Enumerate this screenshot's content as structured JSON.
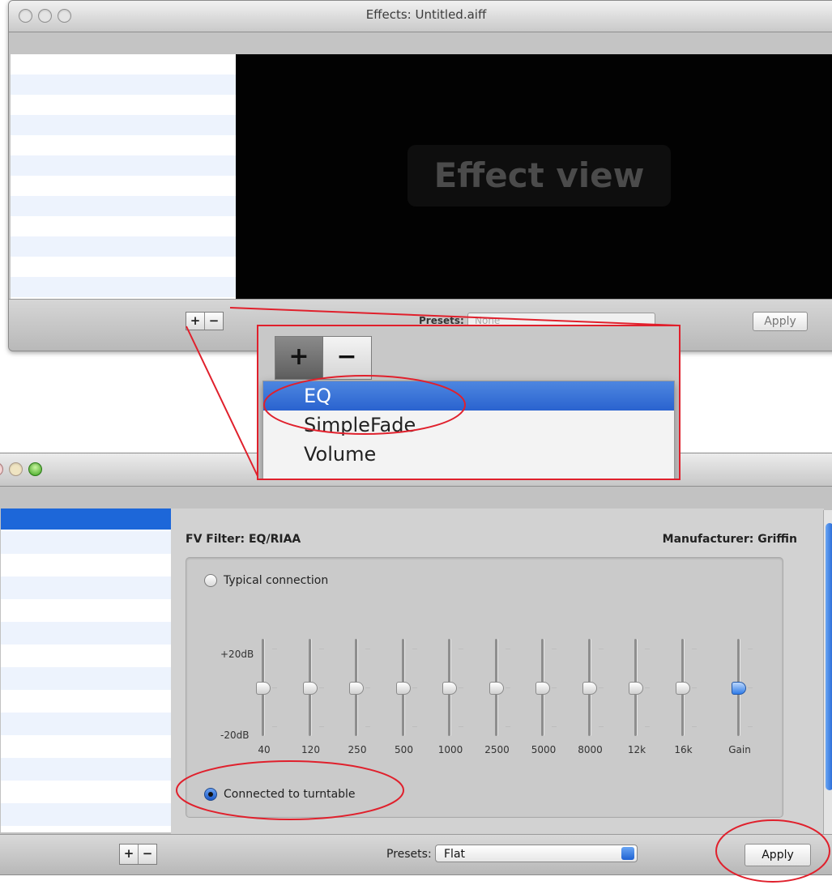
{
  "top_window": {
    "title": "Effects: Untitled.aiff",
    "effect_view_label": "Effect view",
    "add_symbol": "+",
    "remove_symbol": "−",
    "presets_label": "Presets:",
    "presets_value": "None",
    "apply_label": "Apply"
  },
  "zoom": {
    "add_symbol": "+",
    "remove_symbol": "−",
    "menu_items": [
      "EQ",
      "SimpleFade",
      "Volume"
    ],
    "highlighted_item": "EQ"
  },
  "bottom_window": {
    "filter_title": "FV Filter: EQ/RIAA",
    "manufacturer": "Manufacturer: Griffin",
    "radio_typical": "Typical connection",
    "radio_turntable": "Connected to turntable",
    "selected_radio": "Connected to turntable",
    "db_top": "+20dB",
    "db_bottom": "-20dB",
    "bands": [
      {
        "label": "40",
        "level": 0.5
      },
      {
        "label": "120",
        "level": 0.5
      },
      {
        "label": "250",
        "level": 0.5
      },
      {
        "label": "500",
        "level": 0.5
      },
      {
        "label": "1000",
        "level": 0.5
      },
      {
        "label": "2500",
        "level": 0.5
      },
      {
        "label": "5000",
        "level": 0.5
      },
      {
        "label": "8000",
        "level": 0.5
      },
      {
        "label": "12k",
        "level": 0.5
      },
      {
        "label": "16k",
        "level": 0.5
      },
      {
        "label": "Gain",
        "level": 0.5
      }
    ],
    "add_symbol": "+",
    "remove_symbol": "−",
    "presets_label": "Presets:",
    "presets_value": "Flat",
    "apply_label": "Apply"
  },
  "colors": {
    "annotation_red": "#e0202c",
    "selection_blue": "#1d67d9"
  }
}
